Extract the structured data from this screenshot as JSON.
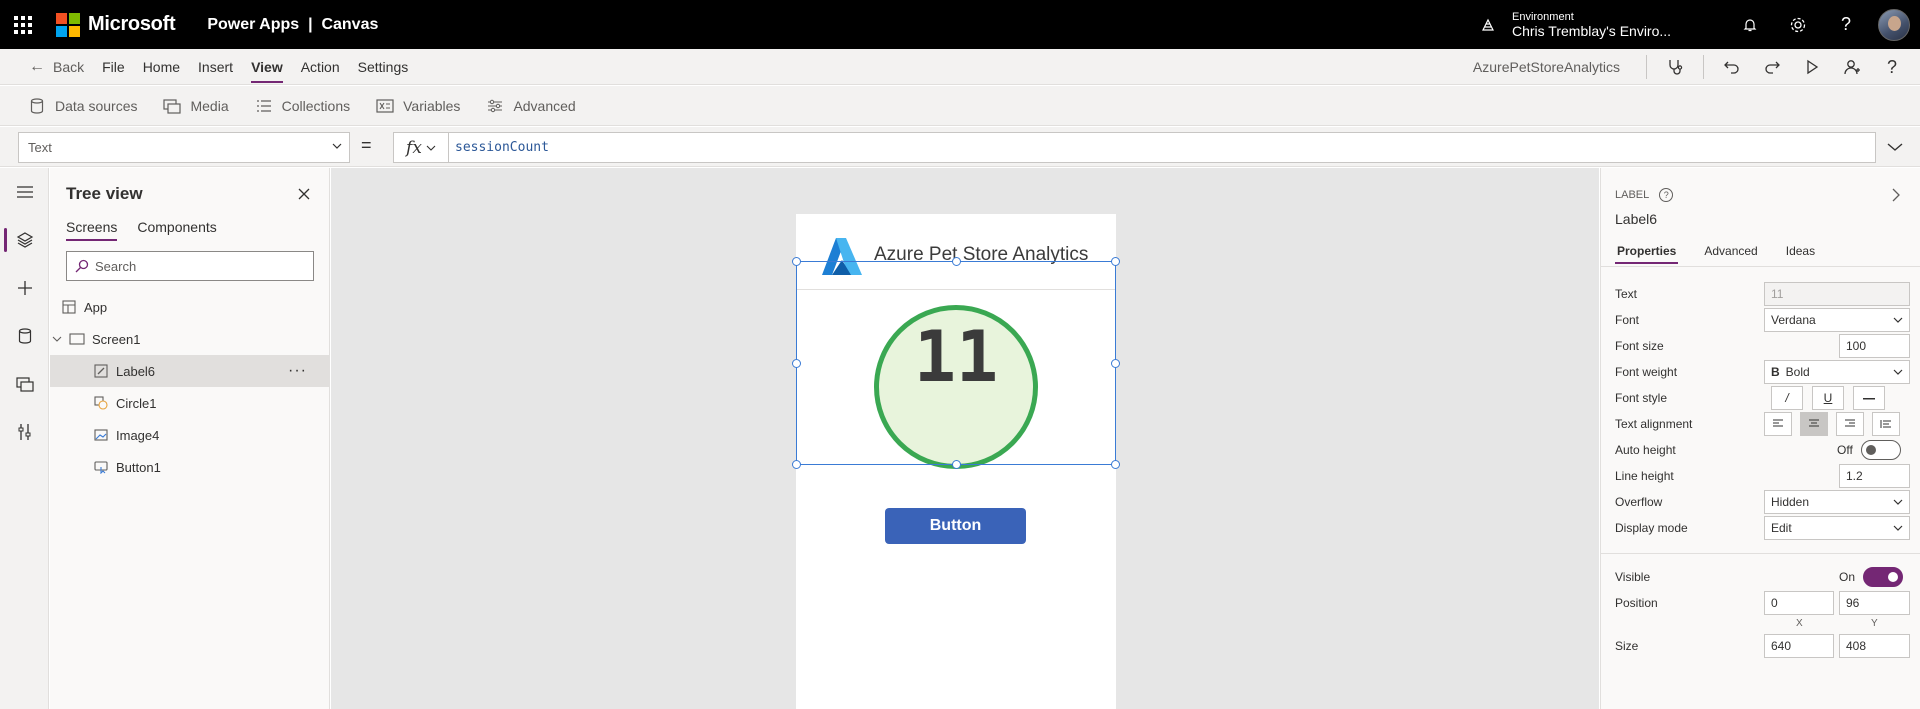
{
  "topbar": {
    "brand": "Microsoft",
    "app_name": "Power Apps  |  Canvas",
    "environment_label": "Environment",
    "environment_name": "Chris Tremblay's Enviro...",
    "ms_colors": [
      "#f25022",
      "#7fba00",
      "#00a4ef",
      "#ffb900"
    ]
  },
  "menubar": {
    "back": "Back",
    "items": [
      "File",
      "Home",
      "Insert",
      "View",
      "Action",
      "Settings"
    ],
    "active": "View",
    "app_title": "AzurePetStoreAnalytics"
  },
  "subbar": {
    "items": [
      "Data sources",
      "Media",
      "Collections",
      "Variables",
      "Advanced"
    ]
  },
  "formula": {
    "property": "Text",
    "equals": "=",
    "fx": "fx",
    "value": "sessionCount"
  },
  "treeview": {
    "title": "Tree view",
    "tabs": [
      "Screens",
      "Components"
    ],
    "search_placeholder": "Search",
    "items": [
      {
        "label": "App",
        "icon": "app-icon"
      },
      {
        "label": "Screen1",
        "icon": "screen-icon"
      },
      {
        "label": "Label6",
        "icon": "label-icon",
        "selected": true,
        "more": "···"
      },
      {
        "label": "Circle1",
        "icon": "circle-shape-icon"
      },
      {
        "label": "Image4",
        "icon": "image-icon"
      },
      {
        "label": "Button1",
        "icon": "button-icon"
      }
    ]
  },
  "canvas": {
    "header_title": "Azure Pet Store Analytics",
    "number": "11",
    "button_label": "Button",
    "accent_green": "#3aa852",
    "button_color": "#3a63b8"
  },
  "properties": {
    "control_type": "LABEL",
    "control_name": "Label6",
    "tabs": [
      "Properties",
      "Advanced",
      "Ideas"
    ],
    "rows": {
      "text": {
        "label": "Text",
        "value": "11"
      },
      "font": {
        "label": "Font",
        "value": "Verdana"
      },
      "font_size": {
        "label": "Font size",
        "value": "100"
      },
      "font_weight": {
        "label": "Font weight",
        "value": "Bold",
        "prefix": "B"
      },
      "font_style": {
        "label": "Font style",
        "buttons": [
          "/",
          "U",
          "—"
        ]
      },
      "text_alignment": {
        "label": "Text alignment"
      },
      "auto_height": {
        "label": "Auto height",
        "state": "Off"
      },
      "line_height": {
        "label": "Line height",
        "value": "1.2"
      },
      "overflow": {
        "label": "Overflow",
        "value": "Hidden"
      },
      "display_mode": {
        "label": "Display mode",
        "value": "Edit"
      },
      "visible": {
        "label": "Visible",
        "state": "On"
      },
      "position": {
        "label": "Position",
        "x": "0",
        "y": "96",
        "x_caption": "X",
        "y_caption": "Y"
      },
      "size": {
        "label": "Size",
        "width": "640",
        "height": "408"
      }
    }
  }
}
